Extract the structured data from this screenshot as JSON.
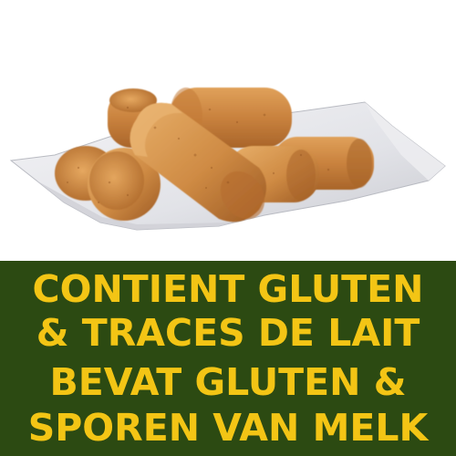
{
  "photo": {
    "subject": "croquettes-on-paper"
  },
  "banner": {
    "line1": "CONTIENT GLUTEN",
    "line2": "& TRACES DE LAIT",
    "line3": "BEVAT GLUTEN &",
    "line4": "SPOREN VAN MELK"
  },
  "colors": {
    "banner_background": "#2c4a12",
    "banner_text": "#f3c515"
  }
}
